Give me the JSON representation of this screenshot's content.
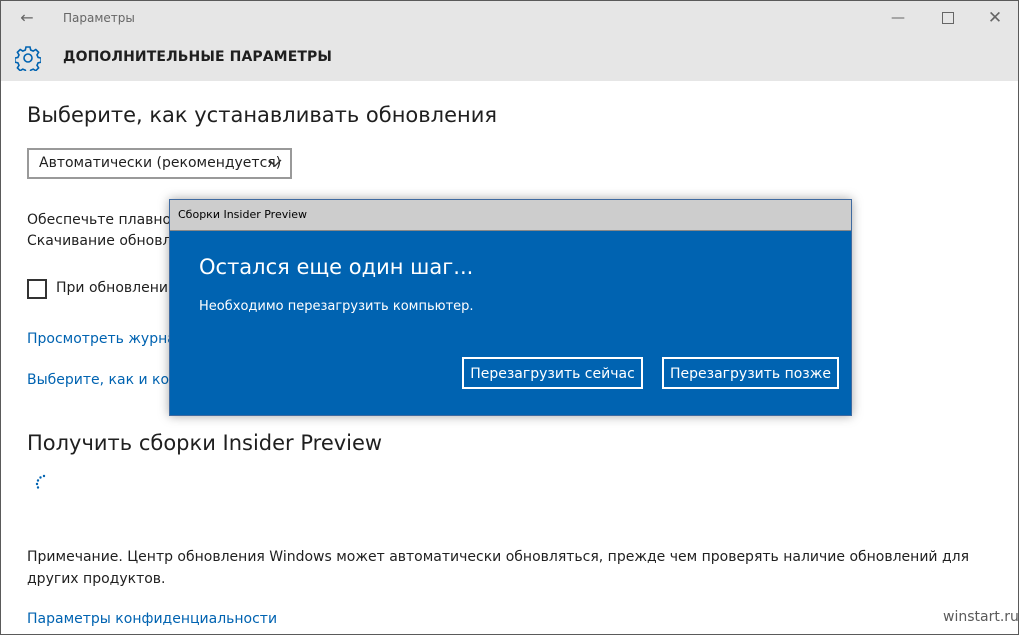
{
  "window": {
    "title": "Параметры",
    "back_icon": "back-arrow-icon",
    "minimize_glyph": "—",
    "close_glyph": "✕"
  },
  "header": {
    "icon": "gear-icon",
    "title": "ДОПОЛНИТЕЛЬНЫЕ ПАРАМЕТРЫ"
  },
  "main": {
    "install_heading": "Выберите, как устанавливать обновления",
    "install_select_value": "Автоматически (рекомендуется)",
    "desc_line1": "Обеспечьте плавнос",
    "desc_line2": "Скачивание обновле",
    "checkbox_label": "При обновлении",
    "checkbox_checked": false,
    "link_history": "Просмотреть журнал",
    "link_choose": "Выберите, как и когд",
    "insider_heading": "Получить сборки Insider Preview",
    "note": "Примечание. Центр обновления Windows может автоматически обновляться, прежде чем проверять наличие обновлений для других продуктов.",
    "link_privacy": "Параметры конфиденциальности"
  },
  "dialog": {
    "title": "Сборки Insider Preview",
    "heading": "Остался еще один шаг...",
    "message": "Необходимо перезагрузить компьютер.",
    "restart_now": "Перезагрузить сейчас",
    "restart_later": "Перезагрузить позже"
  },
  "watermark": "winstart.ru",
  "colors": {
    "accent": "#0063b1",
    "link": "#0063b1",
    "titlebar": "#e6e6e6"
  }
}
